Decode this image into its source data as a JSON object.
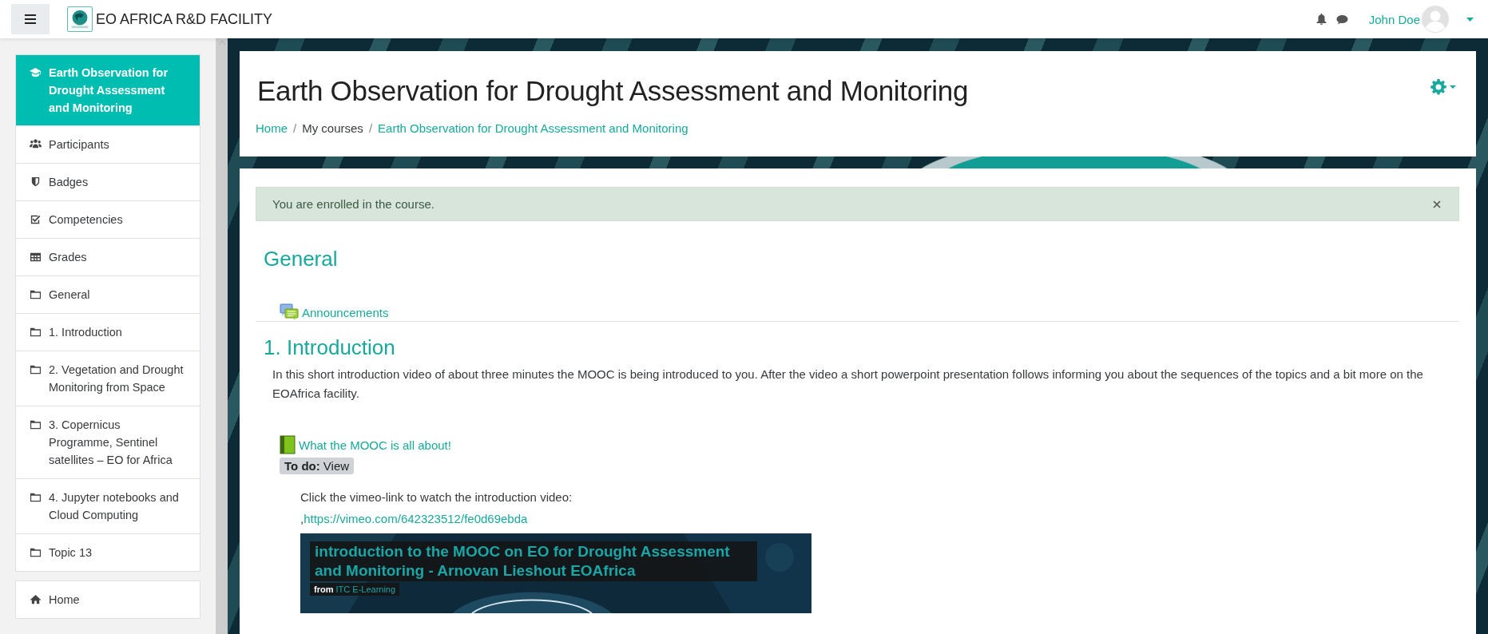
{
  "topbar": {
    "brand": "EO AFRICA R&D FACILITY",
    "user": "John Doe"
  },
  "sidebar": {
    "items": [
      {
        "kind": "course",
        "label": "Earth Observation for Drought Assessment and Monitoring",
        "selected": true
      },
      {
        "kind": "participants",
        "label": "Participants",
        "selected": false
      },
      {
        "kind": "badges",
        "label": "Badges",
        "selected": false
      },
      {
        "kind": "competencies",
        "label": "Competencies",
        "selected": false
      },
      {
        "kind": "grades",
        "label": "Grades",
        "selected": false
      },
      {
        "kind": "section",
        "label": "General",
        "selected": false
      },
      {
        "kind": "section",
        "label": "1. Introduction",
        "selected": false
      },
      {
        "kind": "section",
        "label": "2. Vegetation and Drought Monitoring from Space",
        "selected": false
      },
      {
        "kind": "section",
        "label": "3. Copernicus Programme, Sentinel satellites – EO for Africa",
        "selected": false
      },
      {
        "kind": "section",
        "label": "4. Jupyter notebooks and Cloud Computing",
        "selected": false
      },
      {
        "kind": "section",
        "label": "Topic 13",
        "selected": false
      }
    ],
    "site_items": [
      {
        "kind": "home",
        "label": "Home",
        "selected": false
      }
    ]
  },
  "header": {
    "title": "Earth Observation for Drought Assessment and Monitoring",
    "breadcrumb": [
      {
        "label": "Home",
        "link": true
      },
      {
        "separator": "/",
        "label": "My courses",
        "link": false
      },
      {
        "separator": "/",
        "label": "Earth Observation for Drought Assessment and Monitoring",
        "link": true
      }
    ]
  },
  "alert": {
    "message": "You are enrolled in the course."
  },
  "sections": [
    {
      "title": "General",
      "activities": [
        {
          "kind": "forum",
          "label": "Announcements"
        }
      ]
    },
    {
      "title": "1. Introduction",
      "summary": "In this short introduction video of about three minutes the MOOC is being introduced to you. After the video a short powerpoint presentation follows informing you about the sequences of the topics and a bit more on the EOAfrica facility.",
      "activities": [
        {
          "kind": "book",
          "label": "What the MOOC is all about!",
          "todo": "**To do:** View",
          "description": "Click the vimeo-link to watch the introduction video:",
          "link_prefix": ",",
          "link": "https://vimeo.com/642323512/fe0d69ebda",
          "video": {
            "title": "introduction to the MOOC on EO for Drought Assessment and Monitoring - Arnovan Lieshout EOAfrica",
            "from_label": "from",
            "from_source": "ITC E-Learning"
          }
        }
      ]
    }
  ]
}
